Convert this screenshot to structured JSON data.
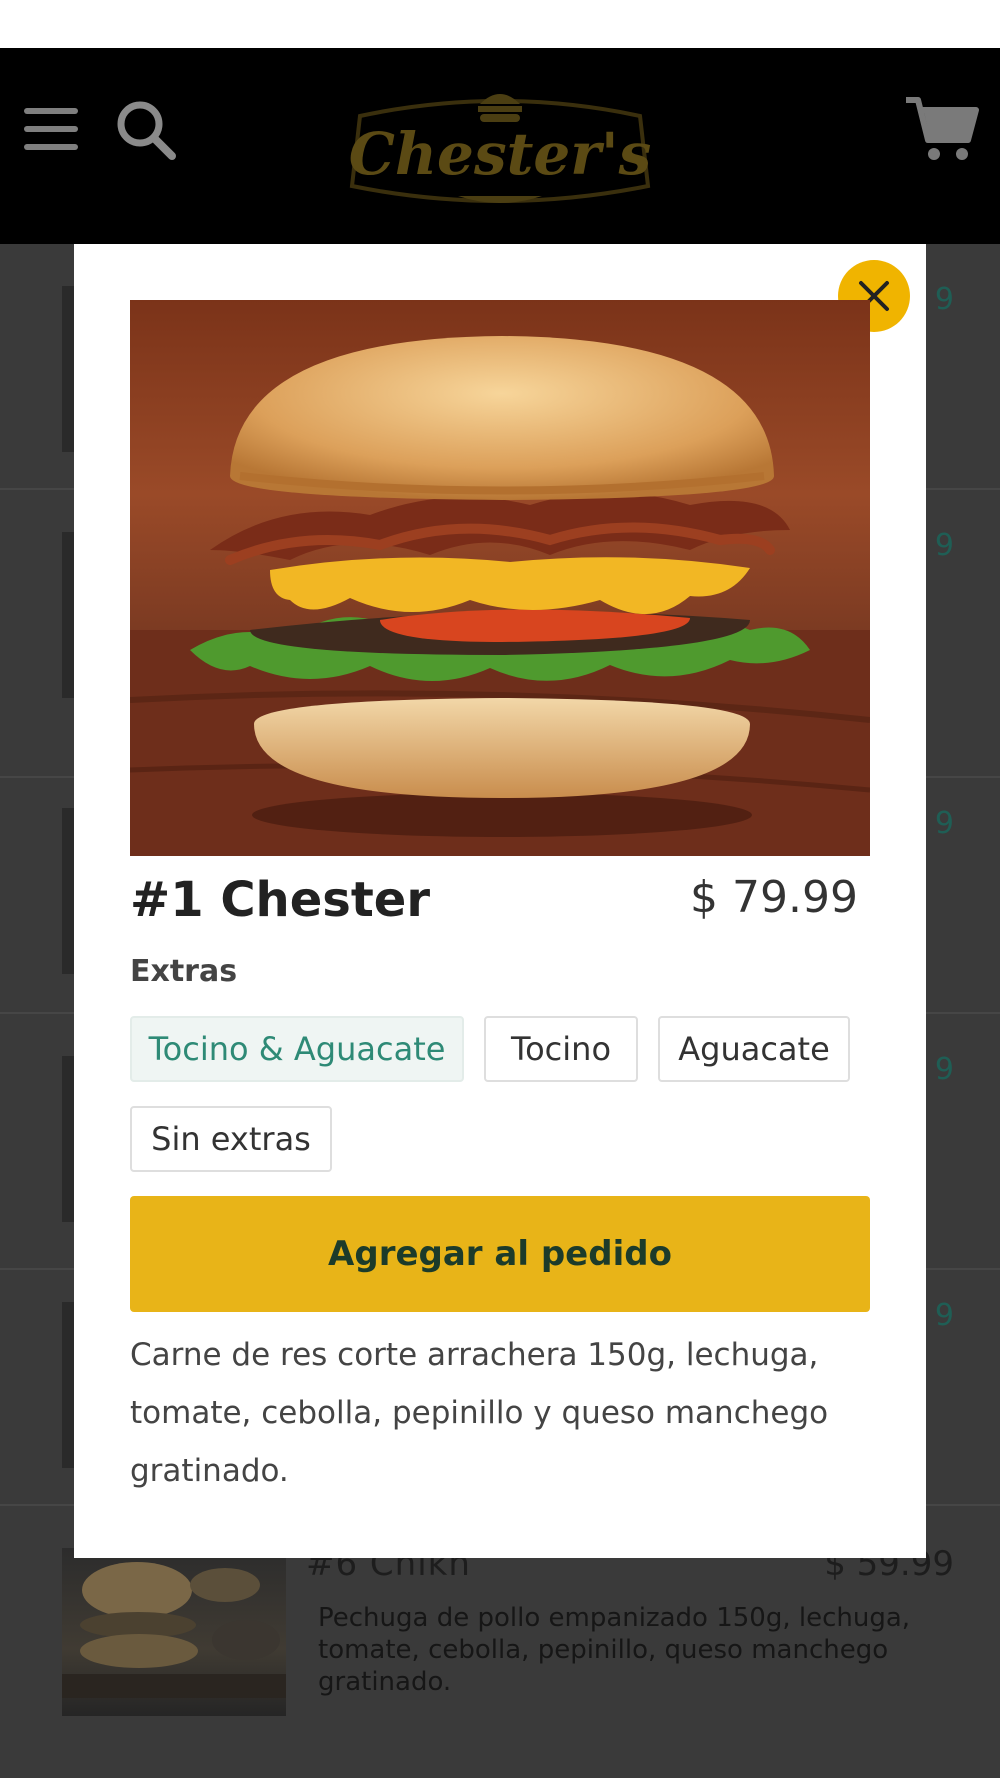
{
  "header": {
    "logo_text": "Chester's"
  },
  "background_list": {
    "side_prices": [
      "9",
      "9",
      "9",
      "9",
      "9"
    ],
    "last_item": {
      "title": "#6 Chikn",
      "price": "$ 59.99",
      "description": "Pechuga de pollo empanizado 150g, lechuga, tomate, cebolla, pepinillo, queso manchego gratinado."
    }
  },
  "modal": {
    "title": "#1 Chester",
    "price": "$ 79.99",
    "extras_label": "Extras",
    "extras_options": [
      "Tocino & Aguacate",
      "Tocino",
      "Aguacate",
      "Sin extras"
    ],
    "selected_extra": "Tocino & Aguacate",
    "add_button_label": "Agregar al pedido",
    "description": "Carne de res corte arrachera 150g, lechuga, tomate, cebolla, pepinillo y queso manchego gratinado."
  },
  "colors": {
    "accent": "#e8b418",
    "selected_chip_text": "#2e8a76",
    "close_button": "#f0b400"
  },
  "icons": [
    "menu-icon",
    "search-icon",
    "cart-icon",
    "close-icon"
  ]
}
